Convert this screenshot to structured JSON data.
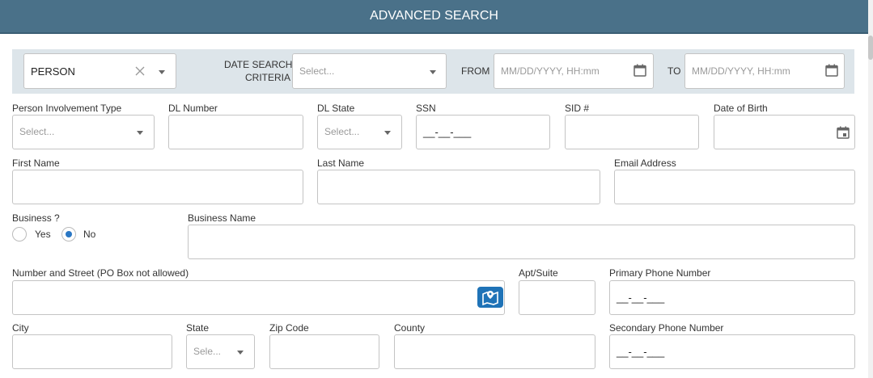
{
  "header": {
    "title": "ADVANCED SEARCH"
  },
  "criteria": {
    "entity_value": "PERSON",
    "date_search_label_line1": "DATE SEARCH",
    "date_search_label_line2": "CRITERIA",
    "date_search_placeholder": "Select...",
    "from_label": "FROM",
    "from_placeholder": "MM/DD/YYYY, HH:mm",
    "to_label": "TO",
    "to_placeholder": "MM/DD/YYYY, HH:mm"
  },
  "form": {
    "person_involvement_type": {
      "label": "Person Involvement Type",
      "placeholder": "Select..."
    },
    "dl_number": {
      "label": "DL Number"
    },
    "dl_state": {
      "label": "DL State",
      "placeholder": "Select..."
    },
    "ssn": {
      "label": "SSN",
      "mask": "__-__-___"
    },
    "sid": {
      "label": "SID #"
    },
    "dob": {
      "label": "Date of Birth"
    },
    "first_name": {
      "label": "First Name"
    },
    "last_name": {
      "label": "Last Name"
    },
    "email": {
      "label": "Email Address"
    },
    "business": {
      "label": "Business ?",
      "yes": "Yes",
      "no": "No",
      "selected": "No"
    },
    "business_name": {
      "label": "Business Name"
    },
    "street": {
      "label": "Number and Street (PO Box not allowed)"
    },
    "apt": {
      "label": "Apt/Suite"
    },
    "primary_phone": {
      "label": "Primary Phone Number",
      "mask": "__-__-___"
    },
    "city": {
      "label": "City"
    },
    "state": {
      "label": "State",
      "placeholder": "Sele..."
    },
    "zip": {
      "label": "Zip Code"
    },
    "county": {
      "label": "County"
    },
    "secondary_phone": {
      "label": "Secondary Phone Number",
      "mask": "__-__-___"
    }
  },
  "colors": {
    "header_bg": "#4a7189",
    "criteria_bg": "#dde5ea",
    "accent": "#1f73b7"
  },
  "icons": {
    "clear": "close-icon",
    "calendar": "calendar-icon",
    "map": "map-marker-icon",
    "dropdown": "chevron-down-icon"
  }
}
